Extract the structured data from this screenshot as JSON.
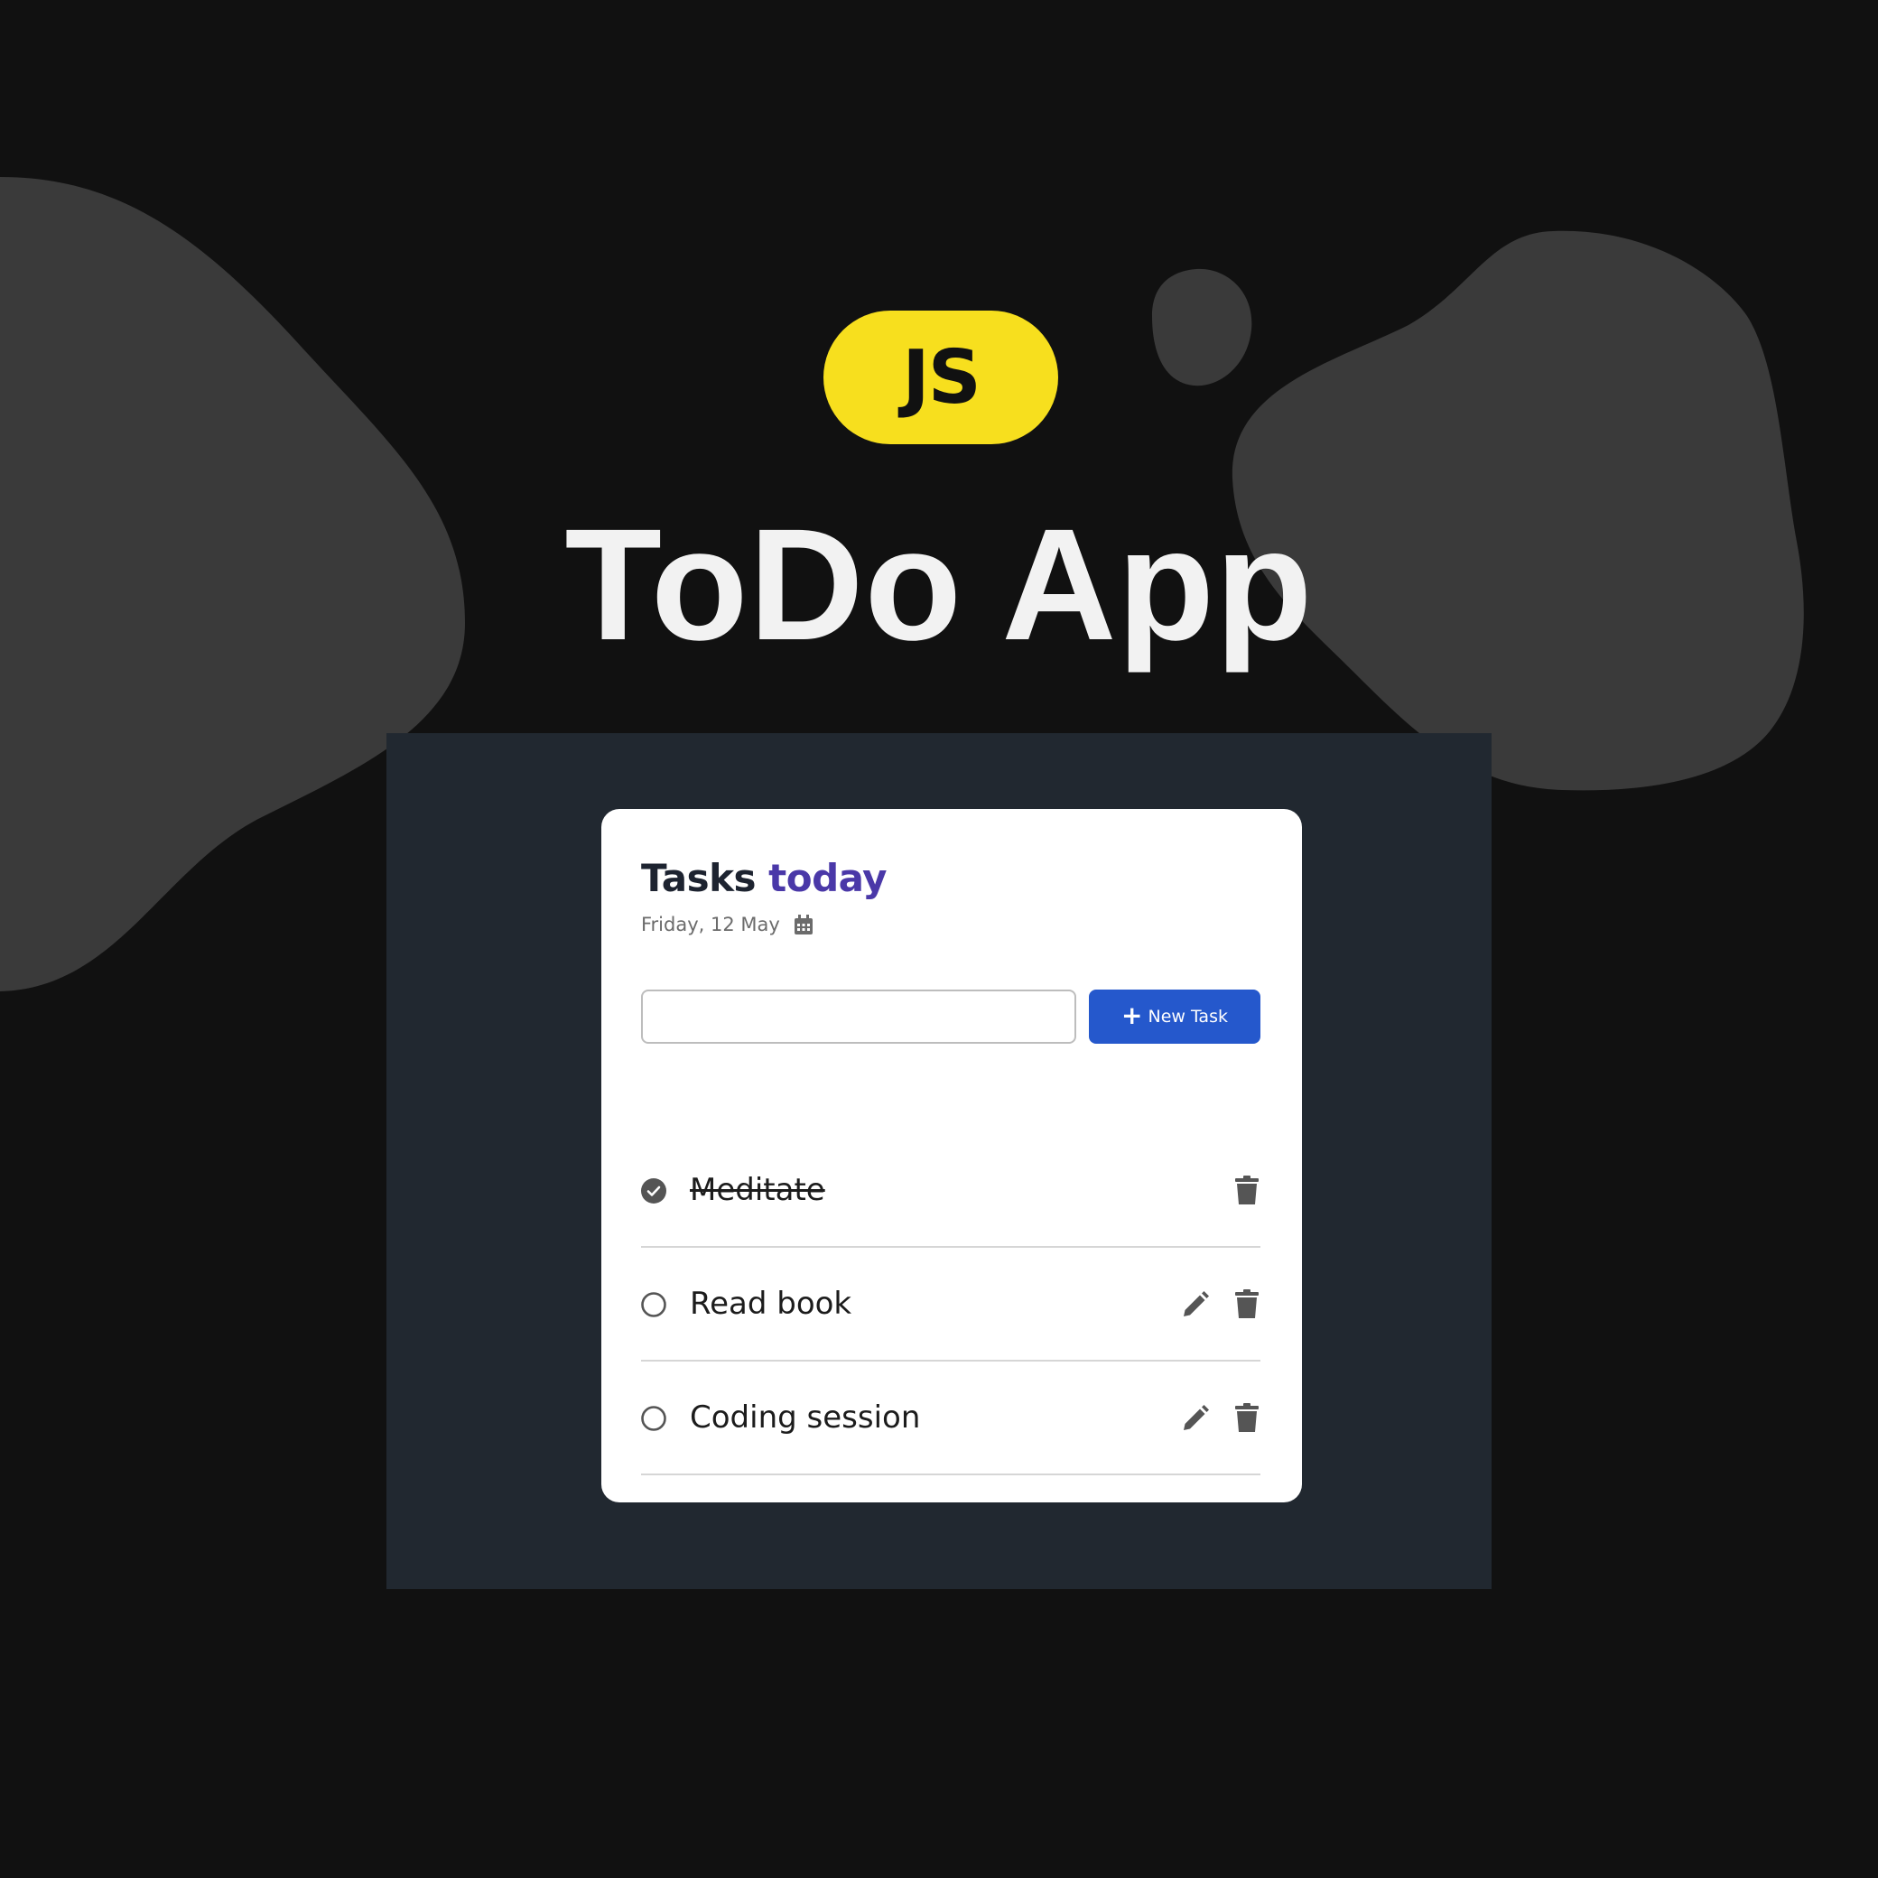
{
  "header": {
    "badge": "JS",
    "title": "ToDo App"
  },
  "card": {
    "title_main": "Tasks",
    "title_accent": "today",
    "date": "Friday, 12 May",
    "input_placeholder": "",
    "new_task_label": "New Task"
  },
  "tasks": [
    {
      "label": "Meditate",
      "done": true
    },
    {
      "label": "Read book",
      "done": false
    },
    {
      "label": "Coding session",
      "done": false
    }
  ],
  "icons": {
    "calendar": "calendar-icon",
    "plus": "plus-icon",
    "checked": "check-circle-icon",
    "unchecked": "circle-icon",
    "edit": "pencil-icon",
    "delete": "trash-icon"
  },
  "colors": {
    "background": "#111111",
    "blob": "#3a3a3a",
    "stage": "#212830",
    "card": "#ffffff",
    "badge": "#f7df1e",
    "accent": "#4a38a8",
    "button": "#2558cc"
  }
}
